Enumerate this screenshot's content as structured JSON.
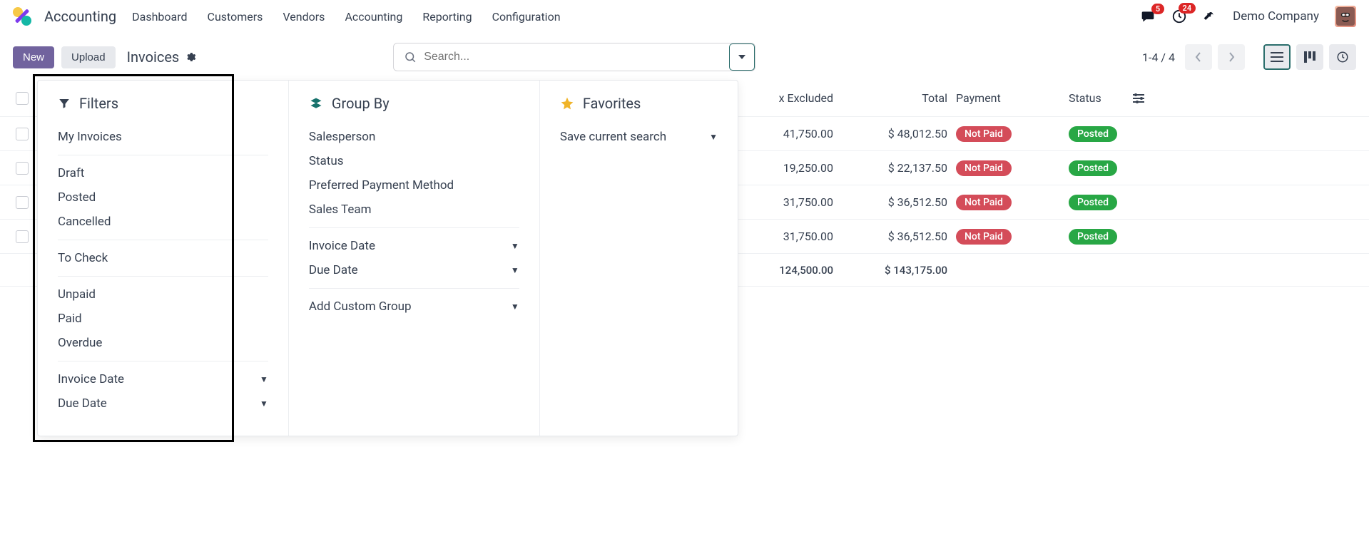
{
  "app": {
    "name": "Accounting"
  },
  "nav": {
    "items": [
      "Dashboard",
      "Customers",
      "Vendors",
      "Accounting",
      "Reporting",
      "Configuration"
    ]
  },
  "header": {
    "messages_badge": "5",
    "activities_badge": "24",
    "company": "Demo Company"
  },
  "ctrl": {
    "new_label": "New",
    "upload_label": "Upload",
    "breadcrumb": "Invoices",
    "search_placeholder": "Search...",
    "pager": "1-4 / 4"
  },
  "panel": {
    "filters": {
      "title": "Filters",
      "groups": [
        [
          "My Invoices"
        ],
        [
          "Draft",
          "Posted",
          "Cancelled"
        ],
        [
          "To Check"
        ],
        [
          "Unpaid",
          "Paid",
          "Overdue"
        ]
      ],
      "date_items": [
        "Invoice Date",
        "Due Date"
      ]
    },
    "groupby": {
      "title": "Group By",
      "items": [
        "Salesperson",
        "Status",
        "Preferred Payment Method",
        "Sales Team"
      ],
      "date_items": [
        "Invoice Date",
        "Due Date"
      ],
      "custom": "Add Custom Group"
    },
    "favorites": {
      "title": "Favorites",
      "save": "Save current search"
    }
  },
  "table": {
    "headers": {
      "tax_excluded": "x Excluded",
      "total": "Total",
      "payment": "Payment",
      "status": "Status"
    },
    "rows": [
      {
        "tax": "41,750.00",
        "total": "$ 48,012.50",
        "payment": "Not Paid",
        "status": "Posted"
      },
      {
        "tax": "19,250.00",
        "total": "$ 22,137.50",
        "payment": "Not Paid",
        "status": "Posted"
      },
      {
        "tax": "31,750.00",
        "total": "$ 36,512.50",
        "payment": "Not Paid",
        "status": "Posted"
      },
      {
        "tax": "31,750.00",
        "total": "$ 36,512.50",
        "payment": "Not Paid",
        "status": "Posted"
      }
    ],
    "footer": {
      "tax": "124,500.00",
      "total": "$ 143,175.00"
    }
  }
}
